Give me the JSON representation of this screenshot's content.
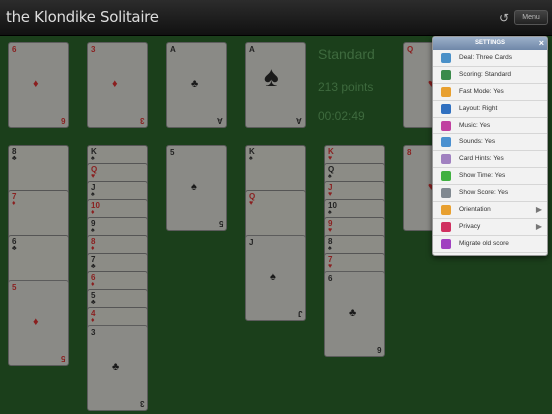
{
  "app": {
    "title": "the Klondike Solitaire",
    "menu_label": "Menu"
  },
  "status": {
    "mode": "Standard",
    "score": "213 points",
    "time": "00:02:49"
  },
  "settings": {
    "header": "SETTINGS",
    "close": "×",
    "items": [
      {
        "label": "Deal: Three Cards",
        "icon": "deal-icon",
        "color": "#4a90c8"
      },
      {
        "label": "Scoring: Standard",
        "icon": "scoring-icon",
        "color": "#3a8a4a"
      },
      {
        "label": "Fast Mode: Yes",
        "icon": "fast-mode-icon",
        "color": "#e8a030"
      },
      {
        "label": "Layout: Right",
        "icon": "layout-icon",
        "color": "#3070c0"
      },
      {
        "label": "Music: Yes",
        "icon": "music-icon",
        "color": "#c040a0"
      },
      {
        "label": "Sounds: Yes",
        "icon": "sounds-icon",
        "color": "#4a90d0"
      },
      {
        "label": "Card Hints: Yes",
        "icon": "hints-icon",
        "color": "#a080c0"
      },
      {
        "label": "Show Time: Yes",
        "icon": "time-icon",
        "color": "#40b040"
      },
      {
        "label": "Show Score: Yes",
        "icon": "score-icon",
        "color": "#808890"
      },
      {
        "label": "Orientation",
        "icon": "orientation-icon",
        "color": "#e8a030",
        "arrow": "▶"
      },
      {
        "label": "Privacy",
        "icon": "privacy-icon",
        "color": "#d03060",
        "arrow": "▶"
      },
      {
        "label": "Migrate old score",
        "icon": "migrate-icon",
        "color": "#a040c0"
      }
    ]
  },
  "foundations": [
    {
      "rank": "6",
      "suit": "♦",
      "color": "red"
    },
    {
      "rank": "3",
      "suit": "♦",
      "color": "red"
    },
    {
      "rank": "A",
      "suit": "♣",
      "color": "black"
    },
    {
      "rank": "A",
      "suit": "♠",
      "color": "black"
    }
  ],
  "waste_top": {
    "rank": "Q",
    "suit": "♥",
    "color": "red"
  },
  "columns": [
    {
      "strips": [
        {
          "rank": "8",
          "suit": "♣",
          "color": "black"
        },
        {
          "rank": "7",
          "suit": "♦",
          "color": "red"
        },
        {
          "rank": "6",
          "suit": "♣",
          "color": "black"
        }
      ],
      "top": {
        "rank": "5",
        "suit": "♦",
        "color": "red"
      }
    },
    {
      "strips": [
        {
          "rank": "K",
          "suit": "♠",
          "color": "black"
        },
        {
          "rank": "Q",
          "suit": "♥",
          "color": "red"
        },
        {
          "rank": "J",
          "suit": "♠",
          "color": "black"
        },
        {
          "rank": "10",
          "suit": "♦",
          "color": "red"
        },
        {
          "rank": "9",
          "suit": "♠",
          "color": "black"
        },
        {
          "rank": "8",
          "suit": "♦",
          "color": "red"
        },
        {
          "rank": "7",
          "suit": "♣",
          "color": "black"
        },
        {
          "rank": "6",
          "suit": "♦",
          "color": "red"
        },
        {
          "rank": "5",
          "suit": "♣",
          "color": "black"
        },
        {
          "rank": "4",
          "suit": "♦",
          "color": "red"
        }
      ],
      "top": {
        "rank": "3",
        "suit": "♣",
        "color": "black"
      }
    },
    {
      "strips": [],
      "top": {
        "rank": "5",
        "suit": "♠",
        "color": "black"
      }
    },
    {
      "strips": [
        {
          "rank": "K",
          "suit": "♠",
          "color": "black"
        },
        {
          "rank": "Q",
          "suit": "♥",
          "color": "red"
        }
      ],
      "top": {
        "rank": "J",
        "suit": "♠",
        "color": "black"
      }
    },
    {
      "strips": [
        {
          "rank": "K",
          "suit": "♥",
          "color": "red"
        },
        {
          "rank": "Q",
          "suit": "♠",
          "color": "black"
        },
        {
          "rank": "J",
          "suit": "♥",
          "color": "red"
        },
        {
          "rank": "10",
          "suit": "♠",
          "color": "black"
        },
        {
          "rank": "9",
          "suit": "♥",
          "color": "red"
        },
        {
          "rank": "8",
          "suit": "♠",
          "color": "black"
        },
        {
          "rank": "7",
          "suit": "♥",
          "color": "red"
        }
      ],
      "top": {
        "rank": "6",
        "suit": "♣",
        "color": "black"
      }
    },
    {
      "strips": [],
      "top": {
        "rank": "8",
        "suit": "♥",
        "color": "red"
      }
    }
  ]
}
